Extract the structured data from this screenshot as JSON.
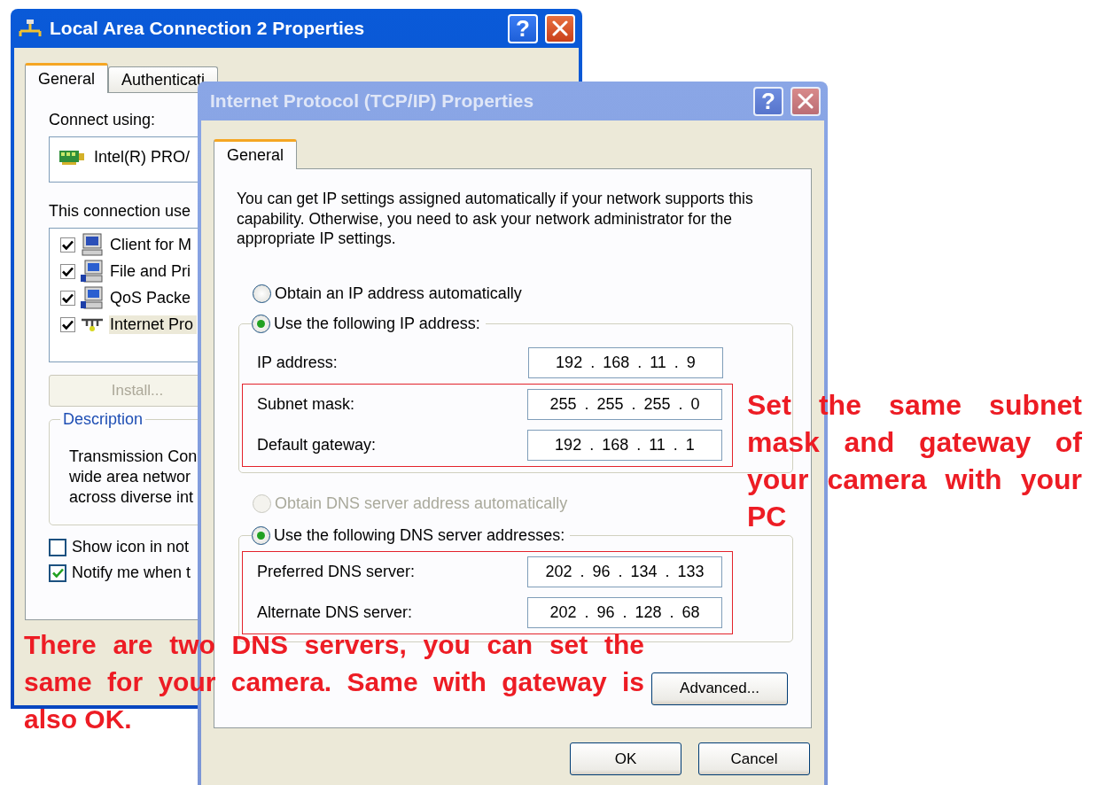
{
  "lan_dialog": {
    "active": true,
    "title": "Local Area Connection 2 Properties",
    "help_button": "?",
    "tabs": [
      {
        "label": "General",
        "selected": true
      },
      {
        "label": "Authenticati",
        "selected": false
      }
    ],
    "connect_using_label": "Connect using:",
    "adapter": "Intel(R) PRO/",
    "components_label": "This connection use",
    "components": [
      {
        "kind": "client",
        "label": "Client for M",
        "checked": true,
        "selected": false
      },
      {
        "kind": "service",
        "label": "File and Pri",
        "checked": true,
        "selected": false
      },
      {
        "kind": "service",
        "label": "QoS Packe",
        "checked": true,
        "selected": false
      },
      {
        "kind": "protocol",
        "label": "Internet Pro",
        "checked": true,
        "selected": true
      }
    ],
    "install_button": {
      "label": "Install...",
      "disabled": true
    },
    "description": {
      "title": "Description",
      "lines": [
        "Transmission Con",
        "wide area networ",
        "across diverse int"
      ]
    },
    "options": [
      {
        "label": "Show icon in not",
        "checked": false
      },
      {
        "label": "Notify me when t",
        "checked": true
      }
    ]
  },
  "tcp_dialog": {
    "active": false,
    "title": "Internet Protocol (TCP/IP) Properties",
    "help_button": "?",
    "tabs": [
      {
        "label": "General",
        "selected": true
      }
    ],
    "intro": "You can get IP settings assigned automatically if your network supports this capability. Otherwise, you need to ask your network administrator for the appropriate IP settings.",
    "ip_choice": [
      {
        "label": "Obtain an IP address automatically",
        "selected": false,
        "disabled": false
      },
      {
        "label": "Use the following IP address:",
        "selected": true,
        "disabled": false
      }
    ],
    "ip_fields": [
      {
        "label": "IP address:",
        "value": "192 . 168 . 11 . 9",
        "highlighted": false
      },
      {
        "label": "Subnet mask:",
        "value": "255 . 255 . 255 . 0",
        "highlighted": true
      },
      {
        "label": "Default gateway:",
        "value": "192 . 168 . 11 . 1",
        "highlighted": true
      }
    ],
    "dns_choice": [
      {
        "label": "Obtain DNS server address automatically",
        "selected": false,
        "disabled": true
      },
      {
        "label": "Use the following DNS server addresses:",
        "selected": true,
        "disabled": false
      }
    ],
    "dns_fields": [
      {
        "label": "Preferred DNS server:",
        "value": "202 . 96 . 134 . 133",
        "highlighted": true
      },
      {
        "label": "Alternate DNS server:",
        "value": "202 . 96 . 128 . 68",
        "highlighted": true
      }
    ],
    "advanced_button": "Advanced...",
    "buttons": [
      "OK",
      "Cancel"
    ]
  },
  "annotations": [
    {
      "kind": "side",
      "text": "Set the same subnet mask and gateway of your camera with your PC"
    },
    {
      "kind": "bottom",
      "text": "There are two DNS servers, you can set the same for your camera. Same with gateway is also OK."
    }
  ]
}
